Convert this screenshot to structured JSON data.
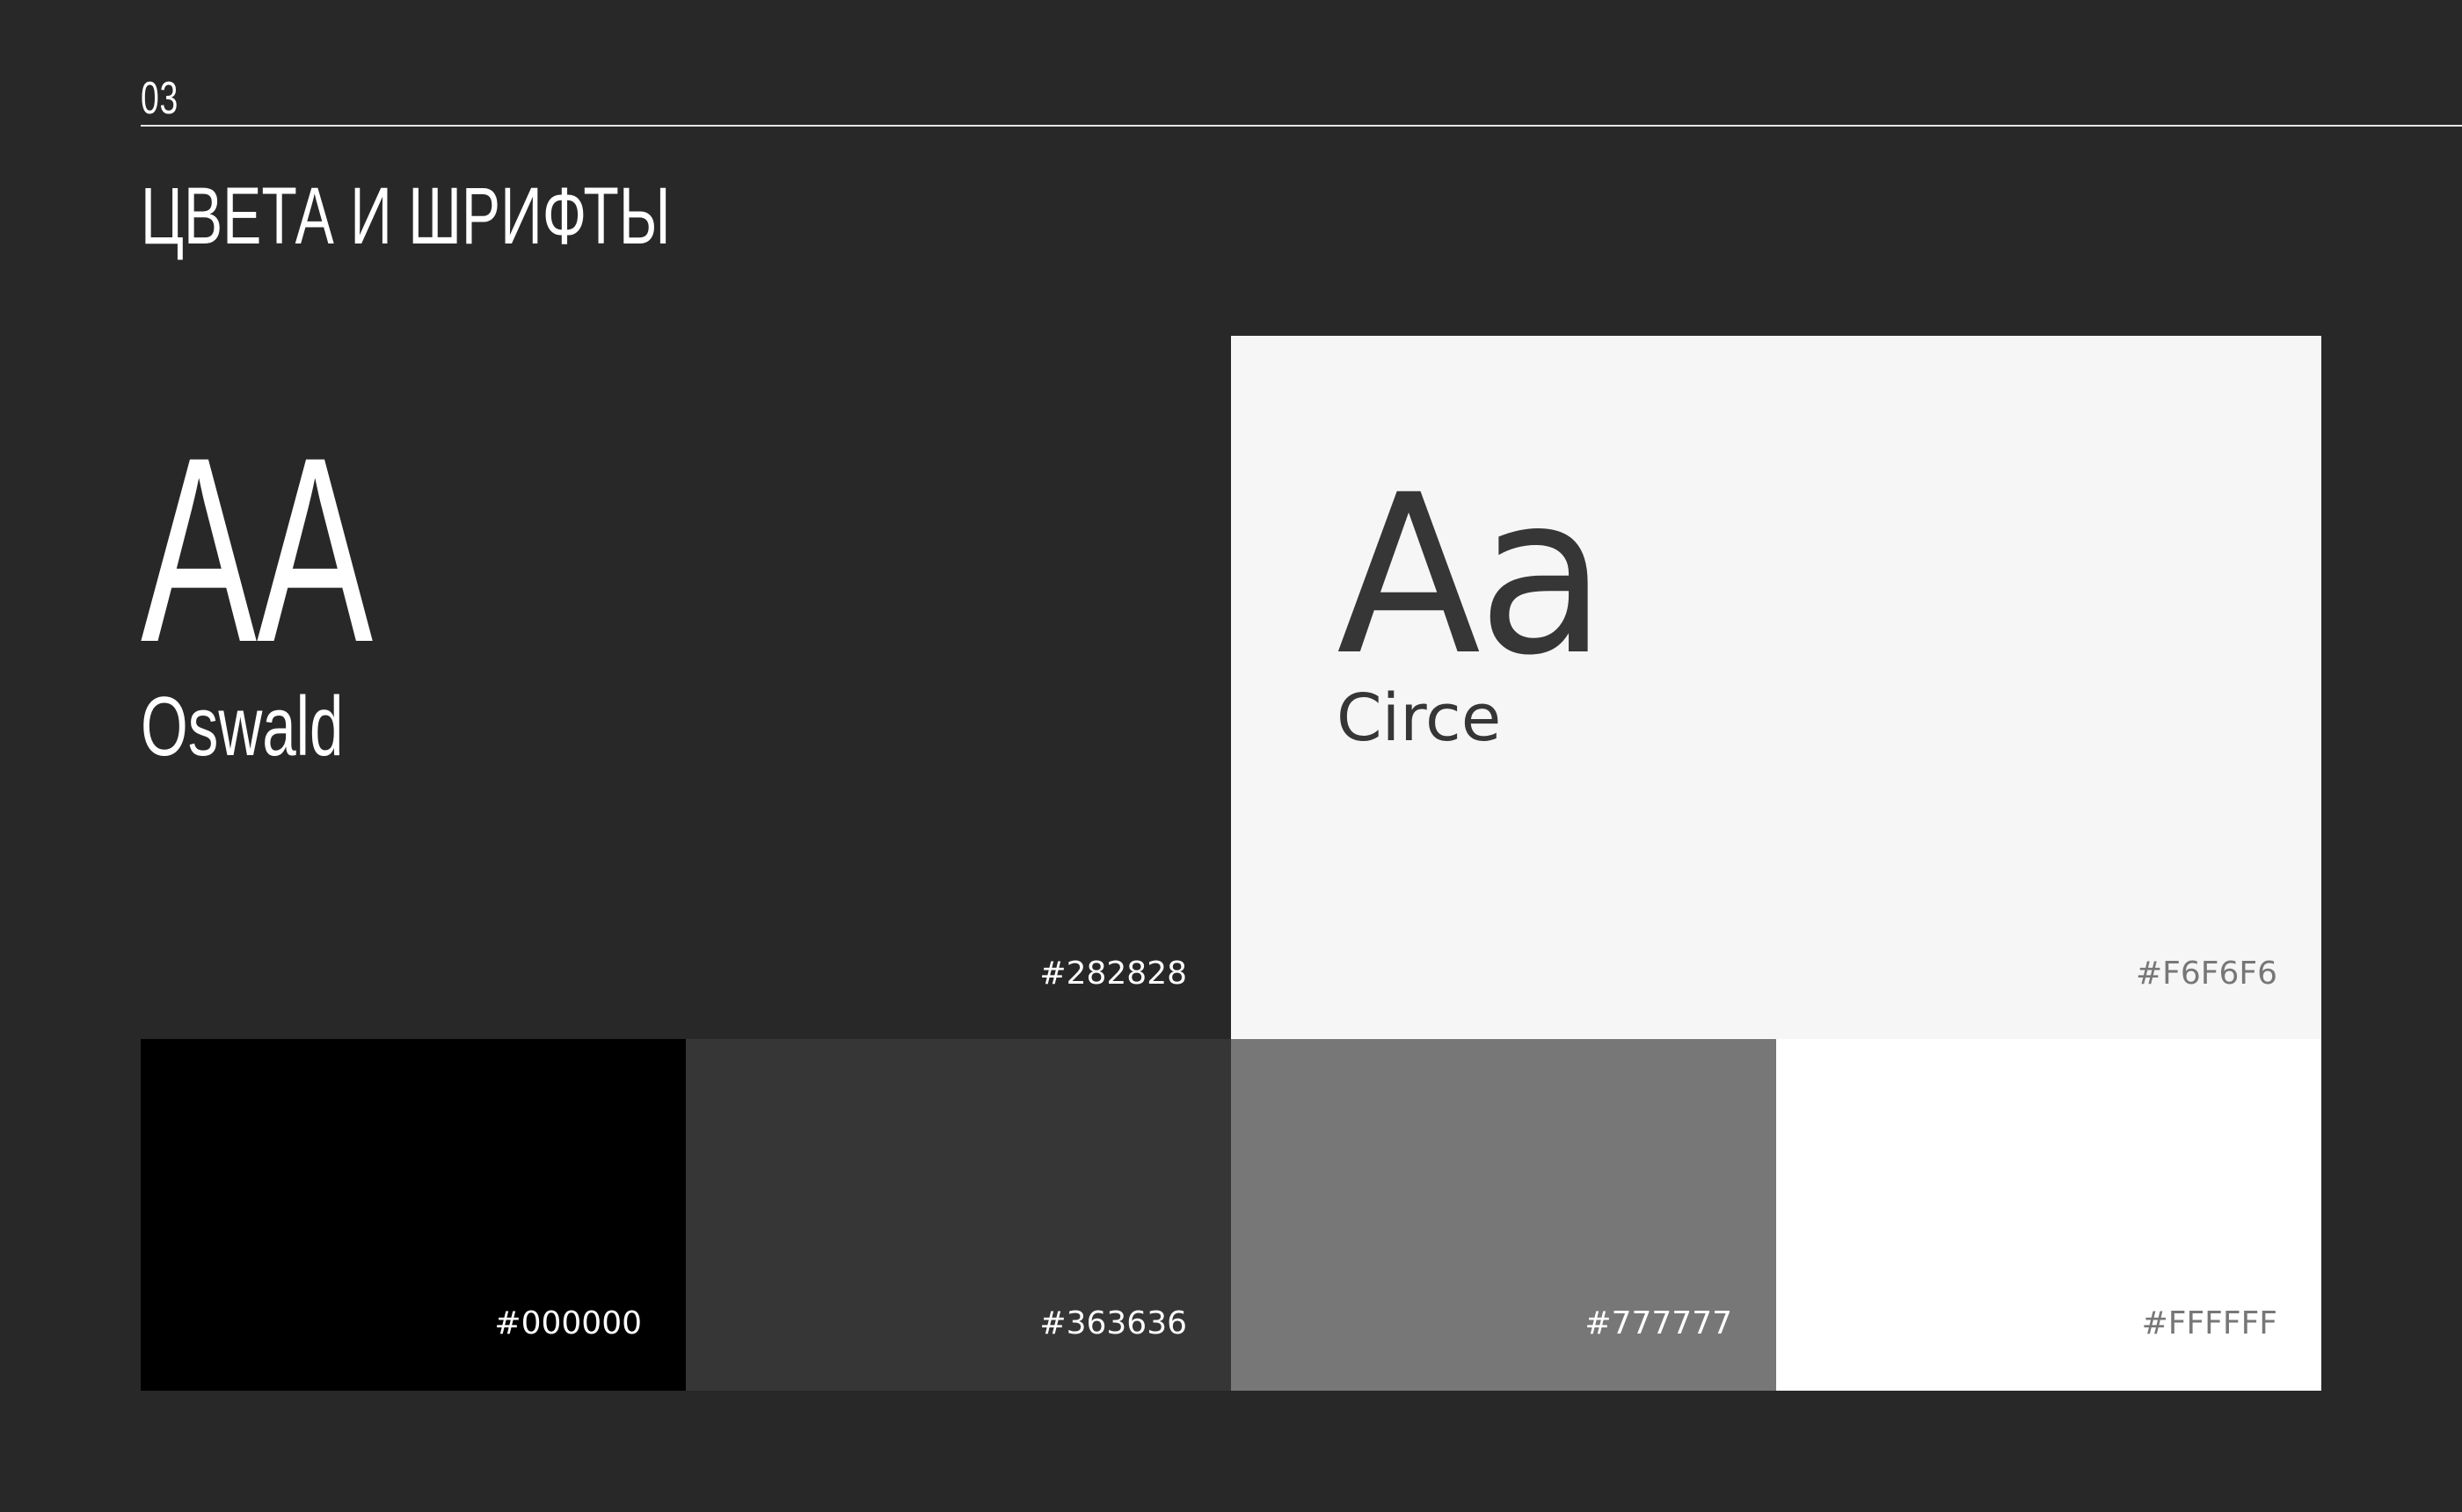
{
  "header": {
    "section_number": "03",
    "title": "ЦВЕТА И ШРИФТЫ"
  },
  "fonts": [
    {
      "glyphs": "AA",
      "name": "Oswald",
      "color_hex": "#282828"
    },
    {
      "glyphs": "Aa",
      "name": "Circe",
      "color_hex": "#F6F6F6"
    }
  ],
  "swatches": [
    {
      "hex": "#000000",
      "color": "#000000",
      "text_color": "#ffffff"
    },
    {
      "hex": "#363636",
      "color": "#363636",
      "text_color": "#ffffff"
    },
    {
      "hex": "#777777",
      "color": "#777777",
      "text_color": "#ffffff"
    },
    {
      "hex": "#FFFFFF",
      "color": "#ffffff",
      "text_color": "#777777"
    }
  ]
}
